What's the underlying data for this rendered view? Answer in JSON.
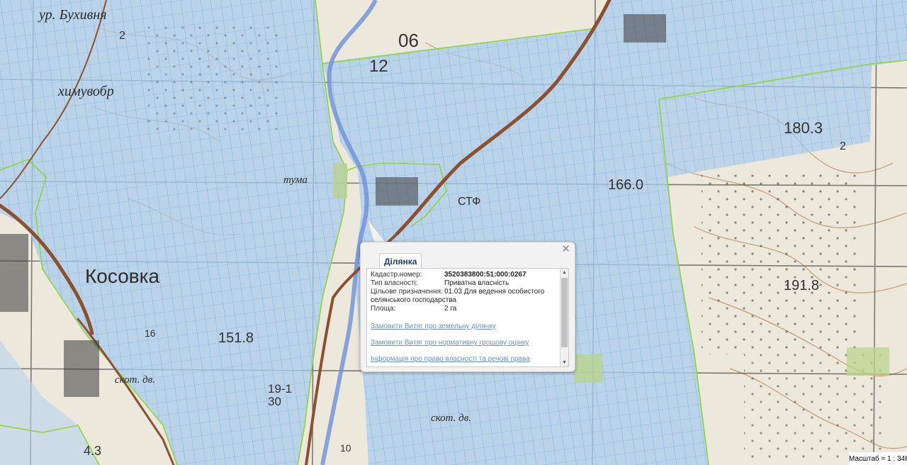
{
  "map": {
    "labels": {
      "bukhivnya": "ур. Бухивня",
      "khimuvobr": "химувобр",
      "kosovka": "Косовка",
      "tumo": "тума",
      "stf": "СТФ",
      "skot1": "скот. дв.",
      "skot2": "скот. дв."
    },
    "numbers": {
      "n06": "06",
      "n12": "12",
      "e1803": "180.3",
      "e1660": "166.0",
      "e1918": "191.8",
      "e1518": "151.8",
      "n2a": "2",
      "n2b": "2",
      "z43": "4.3",
      "z193": "19-1\n30",
      "n16": "16",
      "n10": "10"
    },
    "colors": {
      "background": "#ece8dc",
      "parcel_fill": "#a9ccec",
      "parcel_line": "#7fb8e8",
      "boundary": "#8ed43a",
      "road": "#8a5030",
      "river": "#6e90d8",
      "contour": "#b98858"
    }
  },
  "popup": {
    "tab_label": "Ділянка",
    "close_icon": "close-icon",
    "fields": [
      {
        "label": "Кадастр.номер:",
        "value": "3520383800:51:000:0267",
        "bold": true
      },
      {
        "label": "Тип власності:",
        "value": "Приватна власність"
      },
      {
        "label": "Цільове призначення:",
        "value": "01.03 Для ведення особистого",
        "continuation": "селянського господарства"
      },
      {
        "label": "Площа:",
        "value": "2 га"
      }
    ],
    "links": [
      "Замовити Витяг про земельну ділянку",
      "Замовити Витяг про нормативну грошову оцінку",
      "Інформація про право власності та речові права"
    ]
  },
  "scale": {
    "text": "Масштаб = 1 : 34К"
  }
}
